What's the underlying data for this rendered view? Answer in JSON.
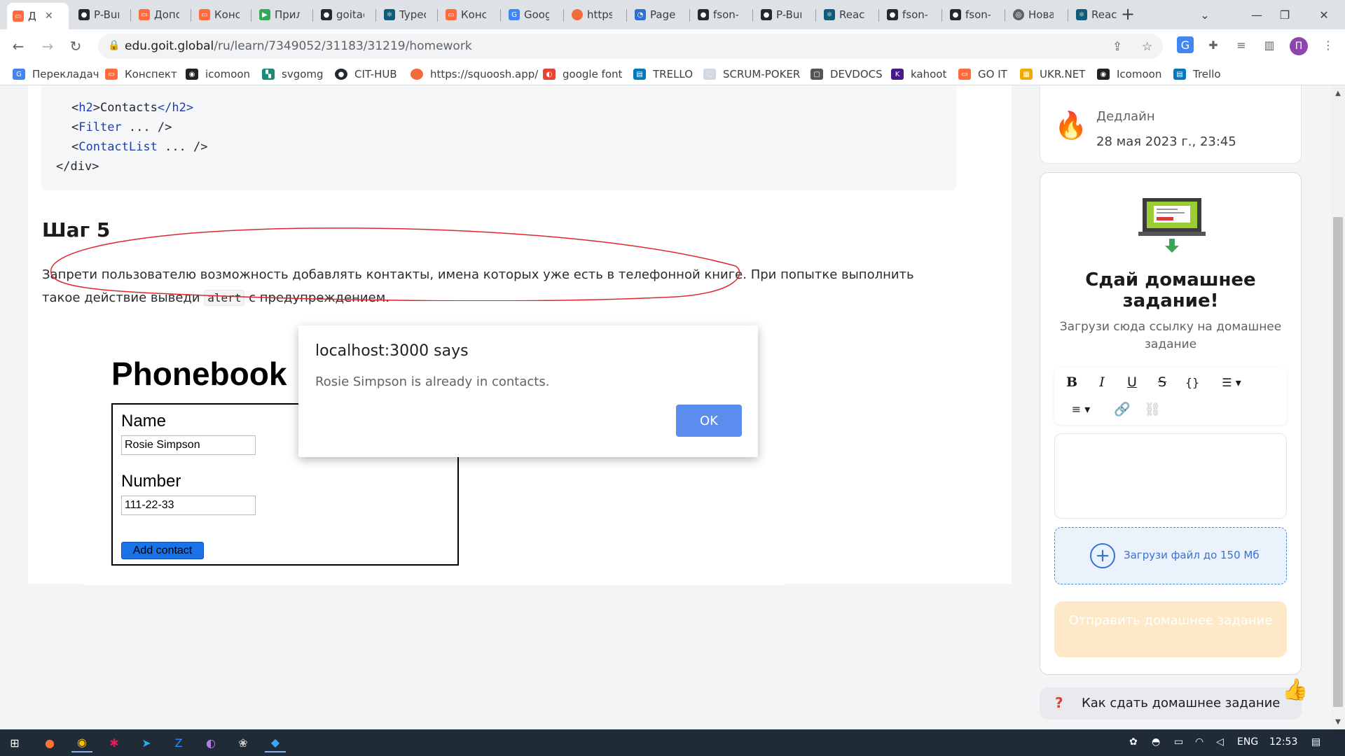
{
  "browser": {
    "tabs": [
      {
        "title": "Д"
      },
      {
        "title": "P-Bur"
      },
      {
        "title": "Допо"
      },
      {
        "title": "Конс"
      },
      {
        "title": "Прил"
      },
      {
        "title": "goitac"
      },
      {
        "title": "Typec"
      },
      {
        "title": "Конс"
      },
      {
        "title": "Goog"
      },
      {
        "title": "https:"
      },
      {
        "title": "PageS"
      },
      {
        "title": "fson-"
      },
      {
        "title": "P-Bur"
      },
      {
        "title": "React"
      },
      {
        "title": "fson-"
      },
      {
        "title": "fson-"
      },
      {
        "title": "Нова"
      },
      {
        "title": "React"
      }
    ],
    "url_host": "edu.goit.global",
    "url_path": "/ru/learn/7349052/31183/31219/homework",
    "profile_initial": "П"
  },
  "bookmarks": [
    {
      "label": "Перекладач"
    },
    {
      "label": "Конспект"
    },
    {
      "label": "icomoon"
    },
    {
      "label": "svgomg"
    },
    {
      "label": "CIT-HUB"
    },
    {
      "label": "https://squoosh.app/"
    },
    {
      "label": "google font"
    },
    {
      "label": "TRELLO"
    },
    {
      "label": "SCRUM-POKER"
    },
    {
      "label": "DEVDOCS"
    },
    {
      "label": "kahoot"
    },
    {
      "label": "GO IT"
    },
    {
      "label": "UKR.NET"
    },
    {
      "label": "Icomoon"
    },
    {
      "label": "Trello"
    }
  ],
  "lesson": {
    "code_lines": [
      {
        "open": "<",
        "tag": "h2",
        "close": ">",
        "text": "Contacts",
        "end": "</h2>"
      },
      {
        "open": "<",
        "tag": "Filter",
        "rest": " ... />"
      },
      {
        "open": "<",
        "tag": "ContactList",
        "rest": " ... />"
      },
      {
        "closing": "</div>"
      }
    ],
    "step_title": "Шаг 5",
    "step_text_before": "Запрети пользователю возможность добавлять контакты, имена которых уже есть в телефонной книге. При попытке выполнить такое действие выведи ",
    "step_code": "alert",
    "step_text_after": " с предупреждением."
  },
  "phonebook": {
    "title": "Phonebook",
    "name_label": "Name",
    "name_value": "Rosie Simpson",
    "number_label": "Number",
    "number_value": "111-22-33",
    "add_button": "Add contact"
  },
  "alert": {
    "title": "localhost:3000 says",
    "message": "Rosie Simpson is already in contacts.",
    "ok_label": "OK"
  },
  "sidebar": {
    "deadline_label": "Дедлайн",
    "deadline_date": "28 мая 2023 г., 23:45",
    "hw_title": "Сдай домашнее задание!",
    "hw_subtitle": "Загрузи сюда ссылку на домашнее задание",
    "upload_text": "Загрузи файл до 150 Мб",
    "submit_label": "Отправить домашнее задание",
    "howto_label": "Как сдать домашнее задание"
  },
  "taskbar": {
    "lang": "ENG",
    "time": "12:53"
  },
  "colors": {
    "accent_blue": "#1a73e8",
    "dialog_ok": "#5b8def",
    "submit_disabled": "#fde8c8",
    "upload_border": "#4a88e8",
    "annotation_red": "#e0262b"
  }
}
